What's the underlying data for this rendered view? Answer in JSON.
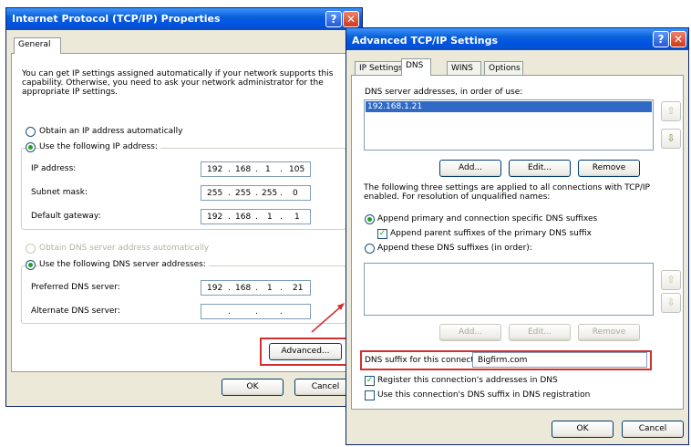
{
  "left_dialog": {
    "title": "Internet Protocol (TCP/IP) Properties",
    "help_glyph": "?",
    "close_glyph": "✕",
    "tab_general": "General",
    "intro": "You can get IP settings assigned automatically if your network supports this capability. Otherwise, you need to ask your network administrator for the appropriate IP settings.",
    "radio_obtain_ip": "Obtain an IP address automatically",
    "radio_use_ip": "Use the following IP address:",
    "ip_label": "IP address:",
    "ip_value": [
      "192",
      "168",
      "1",
      "105"
    ],
    "subnet_label": "Subnet mask:",
    "subnet_value": [
      "255",
      "255",
      "255",
      "0"
    ],
    "gateway_label": "Default gateway:",
    "gateway_value": [
      "192",
      "168",
      "1",
      "1"
    ],
    "radio_obtain_dns": "Obtain DNS server address automatically",
    "radio_use_dns": "Use the following DNS server addresses:",
    "preferred_dns_label": "Preferred DNS server:",
    "preferred_dns_value": [
      "192",
      "168",
      "1",
      "21"
    ],
    "alternate_dns_label": "Alternate DNS server:",
    "alternate_dns_value": [
      ".",
      ".",
      "."
    ],
    "advanced_button": "Advanced...",
    "ok_button": "OK",
    "cancel_button": "Cancel"
  },
  "right_dialog": {
    "title": "Advanced TCP/IP Settings",
    "help_glyph": "?",
    "close_glyph": "✕",
    "tabs": [
      "IP Settings",
      "DNS",
      "WINS",
      "Options"
    ],
    "dns_servers_label": "DNS server addresses, in order of use:",
    "dns_servers": [
      "192.168.1.21"
    ],
    "up_glyph": "⇧",
    "down_glyph": "⇩",
    "add_button": "Add...",
    "edit_button": "Edit...",
    "remove_button": "Remove",
    "suffix_info": "The following three settings are applied to all connections with TCP/IP enabled. For resolution of unqualified names:",
    "radio_append_primary": "Append primary and connection specific DNS suffixes",
    "check_append_parent": "Append parent suffixes of the primary DNS suffix",
    "radio_append_these": "Append these DNS suffixes (in order):",
    "add2_button": "Add...",
    "edit2_button": "Edit...",
    "remove2_button": "Remove",
    "dns_suffix_label": "DNS suffix for this connection:",
    "dns_suffix_value": "Bigfirm.com",
    "check_register": "Register this connection's addresses in DNS",
    "check_use_suffix": "Use this connection's DNS suffix in DNS registration",
    "ok_button": "OK",
    "cancel_button": "Cancel"
  },
  "colors": {
    "highlight_box": "#d03030",
    "title_bar": "#0054e3",
    "selection": "#316ac5"
  }
}
